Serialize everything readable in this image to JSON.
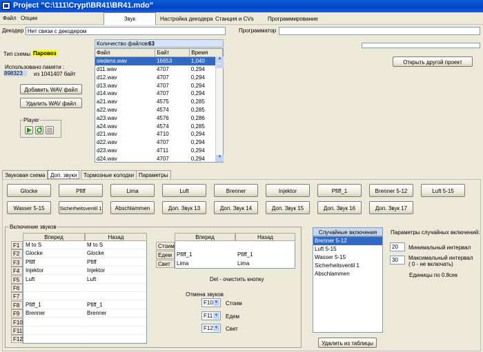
{
  "window": {
    "title": "Project  \"C:\\111\\Crypt\\BR41\\BR41.mdo\""
  },
  "menu": {
    "file": "Файл",
    "options": "Опции"
  },
  "tabs": [
    "Звук",
    "Настройка декодера",
    "Станция и CVs",
    "Программирование"
  ],
  "decoder": {
    "label": "Декодер",
    "value": "Нет связи с декодером"
  },
  "programmer": {
    "label": "Программатор",
    "value": ""
  },
  "scheme": {
    "label": "Тип схемы",
    "value": "Паровоз"
  },
  "memory": {
    "label": "Использовано памяти :",
    "used": "898323",
    "of": "из 1041407 байт"
  },
  "buttons": {
    "add_wav": "Добавить WAV файл",
    "del_wav": "Удалить WAV файл",
    "open_project": "Открыть другой проект",
    "delete_from_table": "Удалить из таблицы"
  },
  "player": {
    "label": "Player"
  },
  "files": {
    "count_label": "Количество файлов:",
    "count": "63",
    "headers": [
      "Файл",
      "Байт",
      "Время"
    ],
    "rows": [
      [
        "siedens.wav",
        "16653",
        "1,040"
      ],
      [
        "d11.wav",
        "4707",
        "0,294"
      ],
      [
        "d12.wav",
        "4707",
        "0,294"
      ],
      [
        "d13.wav",
        "4707",
        "0,294"
      ],
      [
        "d14.wav",
        "4707",
        "0,294"
      ],
      [
        "a21.wav",
        "4575",
        "0,285"
      ],
      [
        "a22.wav",
        "4574",
        "0,285"
      ],
      [
        "a23.wav",
        "4576",
        "0,286"
      ],
      [
        "a24.wav",
        "4574",
        "0,285"
      ],
      [
        "d21.wav",
        "4710",
        "0,294"
      ],
      [
        "d22.wav",
        "4707",
        "0,294"
      ],
      [
        "d23.wav",
        "4711",
        "0,294"
      ],
      [
        "d24.wav",
        "4707",
        "0,294"
      ]
    ]
  },
  "subtabs": [
    "Звуковая схема",
    "Доп. звуки",
    "Тормозные колодки",
    "Параметры"
  ],
  "sound_buttons_row1": [
    "Glocke",
    "Pfiff",
    "Lima",
    "Luft",
    "Brenner",
    "Injektor",
    "Pfiff_1",
    "Brenner 5-12",
    "Luft 5-15"
  ],
  "sound_buttons_row2": [
    "Wasser 5-15",
    "Sicherheitsventil 1",
    "Abschlammen",
    "Доп. Звук 13",
    "Доп. Звук 14",
    "Доп. Звук 15",
    "Доп. Звук 16",
    "Доп. Звук 17"
  ],
  "inclusion": {
    "label": "Включение звуков",
    "headers": [
      "Вперед",
      "Назад"
    ],
    "rows": [
      {
        "key": "F1",
        "fwd": "M to S",
        "back": "M to S"
      },
      {
        "key": "F2",
        "fwd": "Glocke",
        "back": "Glocke"
      },
      {
        "key": "F3",
        "fwd": "Pfiff",
        "back": "Pfiff"
      },
      {
        "key": "F4",
        "fwd": "Injektor",
        "back": "Injektor"
      },
      {
        "key": "F5",
        "fwd": "Luft",
        "back": "Luft"
      },
      {
        "key": "F6",
        "fwd": "",
        "back": ""
      },
      {
        "key": "F7",
        "fwd": "",
        "back": ""
      },
      {
        "key": "F8",
        "fwd": "Pfiff_1",
        "back": "Pfiff_1"
      },
      {
        "key": "F9",
        "fwd": "Brenner",
        "back": "Brenner"
      },
      {
        "key": "F10",
        "fwd": "",
        "back": ""
      },
      {
        "key": "F11",
        "fwd": "",
        "back": ""
      },
      {
        "key": "F12",
        "fwd": "",
        "back": ""
      }
    ]
  },
  "state_table": {
    "headers": [
      "Вперед",
      "Назад"
    ],
    "rows": [
      {
        "key": "Стоим",
        "fwd": "",
        "back": ""
      },
      {
        "key": "Едем",
        "fwd": "Pfiff_1",
        "back": "Pfiff_1"
      },
      {
        "key": "Свет",
        "fwd": "Lima",
        "back": "Lima"
      }
    ]
  },
  "del_hint": "Del - очистить кнопку",
  "cancel": {
    "label": "Отмена звуков",
    "rows": [
      {
        "value": "F10",
        "label": "Стоим"
      },
      {
        "value": "F11",
        "label": "Едем"
      },
      {
        "value": "F12",
        "label": "Свет"
      }
    ]
  },
  "random": {
    "header": "Случайные включения",
    "items": [
      "Brenner 5-12",
      "Luft 5-15",
      "Wasser 5-15",
      "Sicherheitsventil 1",
      "Abschlammen"
    ]
  },
  "random_params": {
    "title": "Параметры случайных включений:",
    "min_value": "20",
    "min_label": "Минимальный интервал",
    "max_value": "30",
    "max_label": "Максимальный интервал",
    "max_note": "( 0 - не включать)",
    "units": "Единицы по 0.8сек"
  }
}
